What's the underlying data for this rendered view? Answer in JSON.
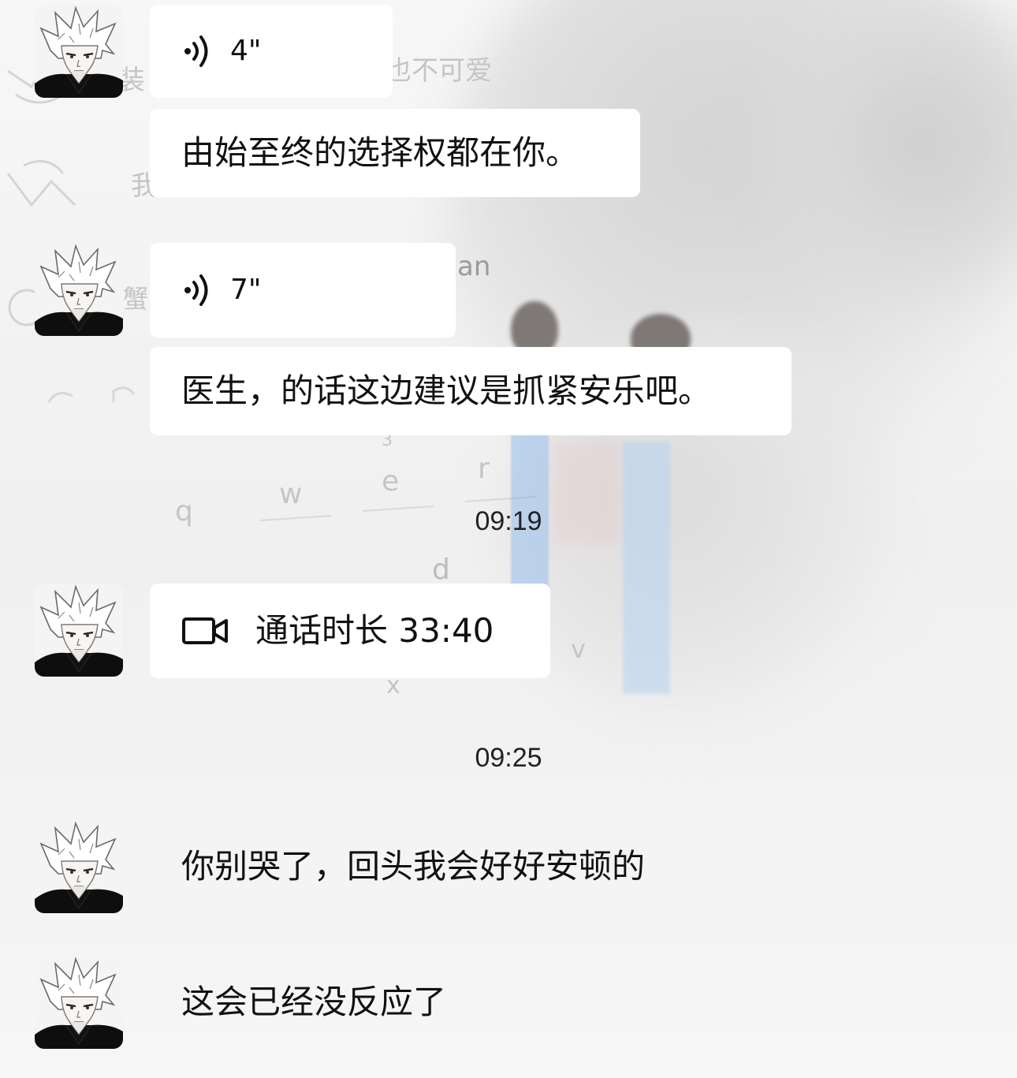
{
  "messages": [
    {
      "kind": "voice",
      "duration": "4\""
    },
    {
      "kind": "text",
      "text": "由始至终的选择权都在你。"
    },
    {
      "kind": "voice",
      "duration": "7\""
    },
    {
      "kind": "text",
      "text": "医生，的话这边建议是抓紧安乐吧。"
    },
    {
      "kind": "time",
      "text": "09:19"
    },
    {
      "kind": "video_call",
      "text": "通话时长 33:40"
    },
    {
      "kind": "time",
      "text": "09:25"
    },
    {
      "kind": "text",
      "text": "你别哭了，回头我会好好安顿的"
    },
    {
      "kind": "text",
      "text": "这会已经没反应了"
    }
  ],
  "background_fragments": [
    "装",
    "也不可爱",
    "我",
    "an",
    "蟹",
    "q",
    "w",
    "e",
    "r",
    "3",
    "d",
    "x",
    "v"
  ],
  "colors": {
    "bubble": "#ffffff",
    "text": "#111111",
    "timestamp": "#222222",
    "background": "#f3f3f3"
  },
  "icons": {
    "voice": "voice-wave-icon",
    "video": "video-camera-icon",
    "avatar": "avatar-anime-boy"
  }
}
